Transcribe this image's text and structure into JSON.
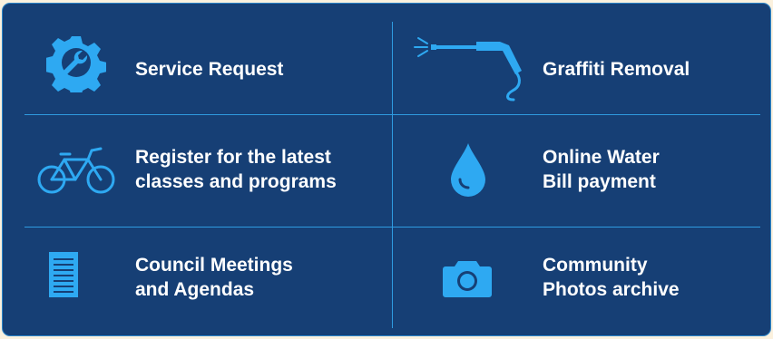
{
  "colors": {
    "panel": "#163f75",
    "accent": "#2ea9f2",
    "divider": "#2f9be0",
    "text": "#ffffff"
  },
  "tiles": [
    {
      "label": "Service Request",
      "icon": "gear-wrench-icon"
    },
    {
      "label": "Graffiti Removal",
      "icon": "pressure-washer-icon"
    },
    {
      "label": "Register for the latest classes and programs",
      "line1": "Register for the latest",
      "line2": "classes and programs",
      "icon": "bicycle-icon"
    },
    {
      "label": "Online Water Bill payment",
      "line1": "Online Water",
      "line2": "Bill payment",
      "icon": "water-drop-icon"
    },
    {
      "label": "Council Meetings and Agendas",
      "line1": "Council Meetings",
      "line2": "and Agendas",
      "icon": "document-icon"
    },
    {
      "label": "Community Photos archive",
      "line1": "Community",
      "line2": "Photos archive",
      "icon": "camera-icon"
    }
  ]
}
